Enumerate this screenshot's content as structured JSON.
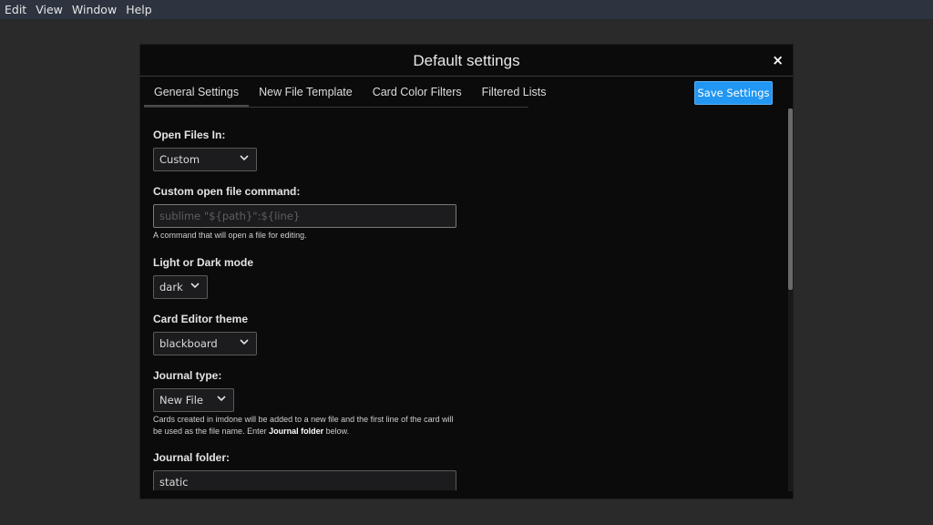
{
  "menubar": {
    "items": [
      "Edit",
      "View",
      "Window",
      "Help"
    ]
  },
  "modal": {
    "title": "Default settings",
    "close_glyph": "×",
    "save_label": "Save Settings",
    "tabs": [
      "General Settings",
      "New File Template",
      "Card Color Filters",
      "Filtered Lists"
    ],
    "active_tab": "General Settings"
  },
  "settings": {
    "open_files_in": {
      "label": "Open Files In:",
      "value": "Custom"
    },
    "custom_command": {
      "label": "Custom open file command:",
      "placeholder": "sublime \"${path}\":${line}",
      "value": "",
      "help": "A command that will open a file for editing."
    },
    "mode": {
      "label": "Light or Dark mode",
      "value": "dark"
    },
    "editor_theme": {
      "label": "Card Editor theme",
      "value": "blackboard"
    },
    "journal_type": {
      "label": "Journal type:",
      "value": "New File",
      "help_prefix": "Cards created in imdone will be added to a new file and the first line of the card will be used as the file name. Enter ",
      "help_bold": "Journal folder",
      "help_suffix": " below."
    },
    "journal_folder": {
      "label": "Journal folder:",
      "value": "static"
    }
  },
  "icons": {
    "close": "close-icon",
    "chevron": "chevron-down-icon"
  }
}
